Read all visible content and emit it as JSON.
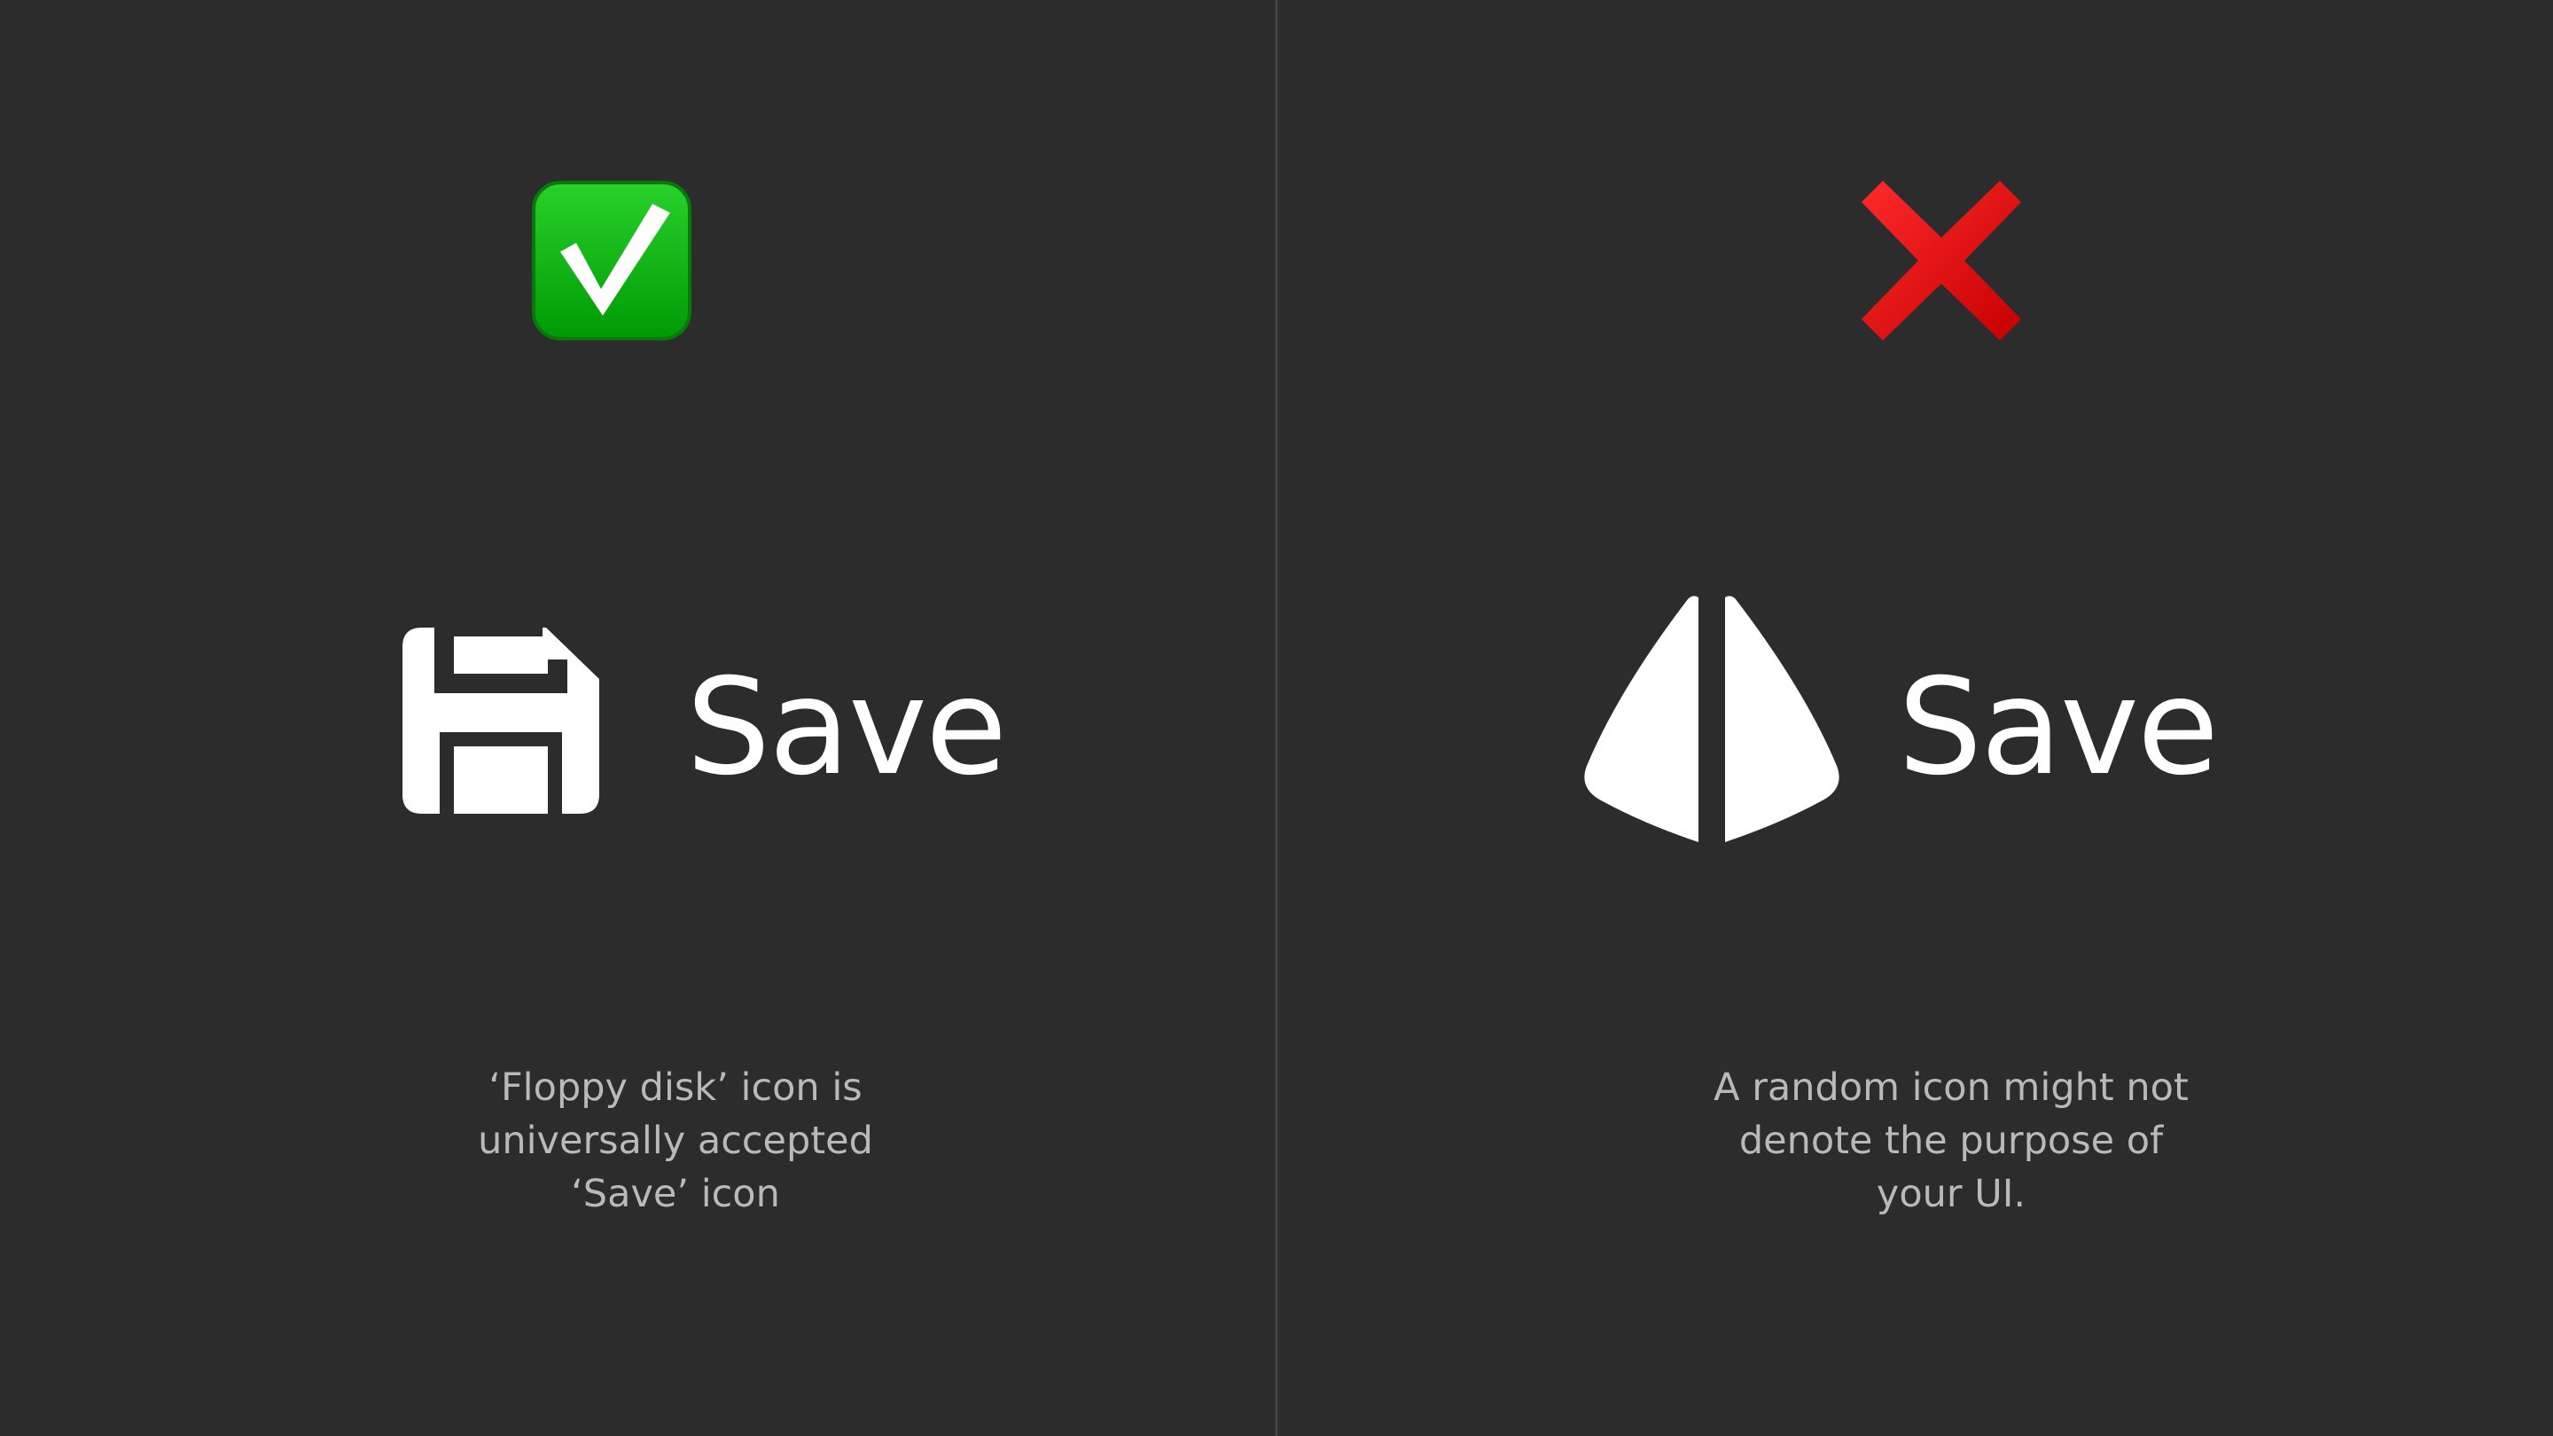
{
  "good": {
    "badge_icon": "check-mark-button-icon",
    "icon": "floppy-disk-icon",
    "label": "Save",
    "caption_lines": [
      "‘Floppy disk’ icon is",
      "universally accepted",
      "‘Save’ icon"
    ],
    "badge_color": "#00b000"
  },
  "bad": {
    "badge_icon": "cross-mark-icon",
    "icon": "random-sail-icon",
    "label": "Save",
    "caption_lines": [
      "A random icon might not",
      "denote the purpose of",
      "your UI."
    ],
    "badge_color": "#e00000"
  },
  "colors": {
    "background": "#2c2c2c",
    "foreground": "#ffffff",
    "caption": "#b9b9b9"
  }
}
